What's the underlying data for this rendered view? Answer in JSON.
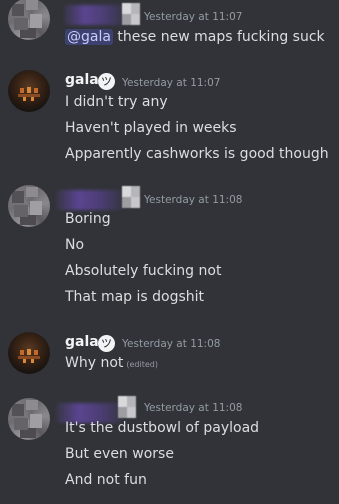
{
  "messages": [
    {
      "timestamp": "Yesterday at 11:07",
      "mention": "@gala",
      "text": " these new maps fucking suck"
    },
    {
      "author": "gala",
      "timestamp": "Yesterday at 11:07",
      "lines": [
        "I didn't try any",
        "Haven't played in weeks",
        "Apparently cashworks is good though"
      ]
    },
    {
      "timestamp": "Yesterday at 11:08",
      "lines": [
        "Boring",
        "No",
        "Absolutely fucking not",
        "That map is dogshit"
      ]
    },
    {
      "author": "gala",
      "timestamp": "Yesterday at 11:08",
      "lines": [
        "Why not"
      ],
      "edited": "(edited)"
    },
    {
      "timestamp": "Yesterday at 11:08",
      "lines": [
        "It's the dustbowl of payload",
        "But even worse",
        "And not fun"
      ]
    }
  ],
  "icons": {
    "badge": "troll-face-icon"
  }
}
